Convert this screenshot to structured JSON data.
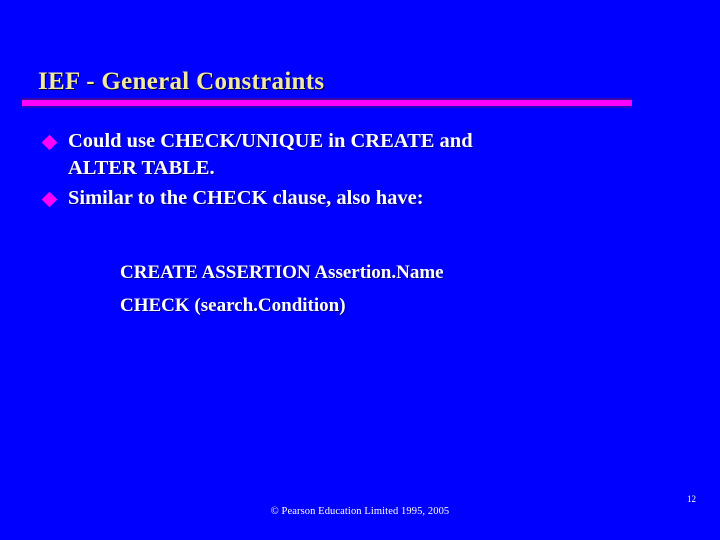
{
  "slide": {
    "background_color": "#0000FF",
    "title": "IEF - General Constraints",
    "title_color": "#F2E9A0",
    "rule_color": "#FF00FF",
    "bullet_marker_color": "#FF00FF",
    "body_text_color": "#FFFFFF",
    "bullets": [
      {
        "marker": "diamond-bullet",
        "line1": "Could use CHECK/UNIQUE in CREATE and",
        "line2": "ALTER TABLE."
      },
      {
        "marker": "diamond-bullet",
        "line1": "Similar to the CHECK clause, also have:",
        "line2": ""
      }
    ],
    "syntax": [
      "CREATE ASSERTION Assertion.Name",
      "CHECK (search.Condition)"
    ],
    "footer": {
      "copyright": "© Pearson Education Limited 1995, 2005",
      "page_number": "12"
    }
  }
}
